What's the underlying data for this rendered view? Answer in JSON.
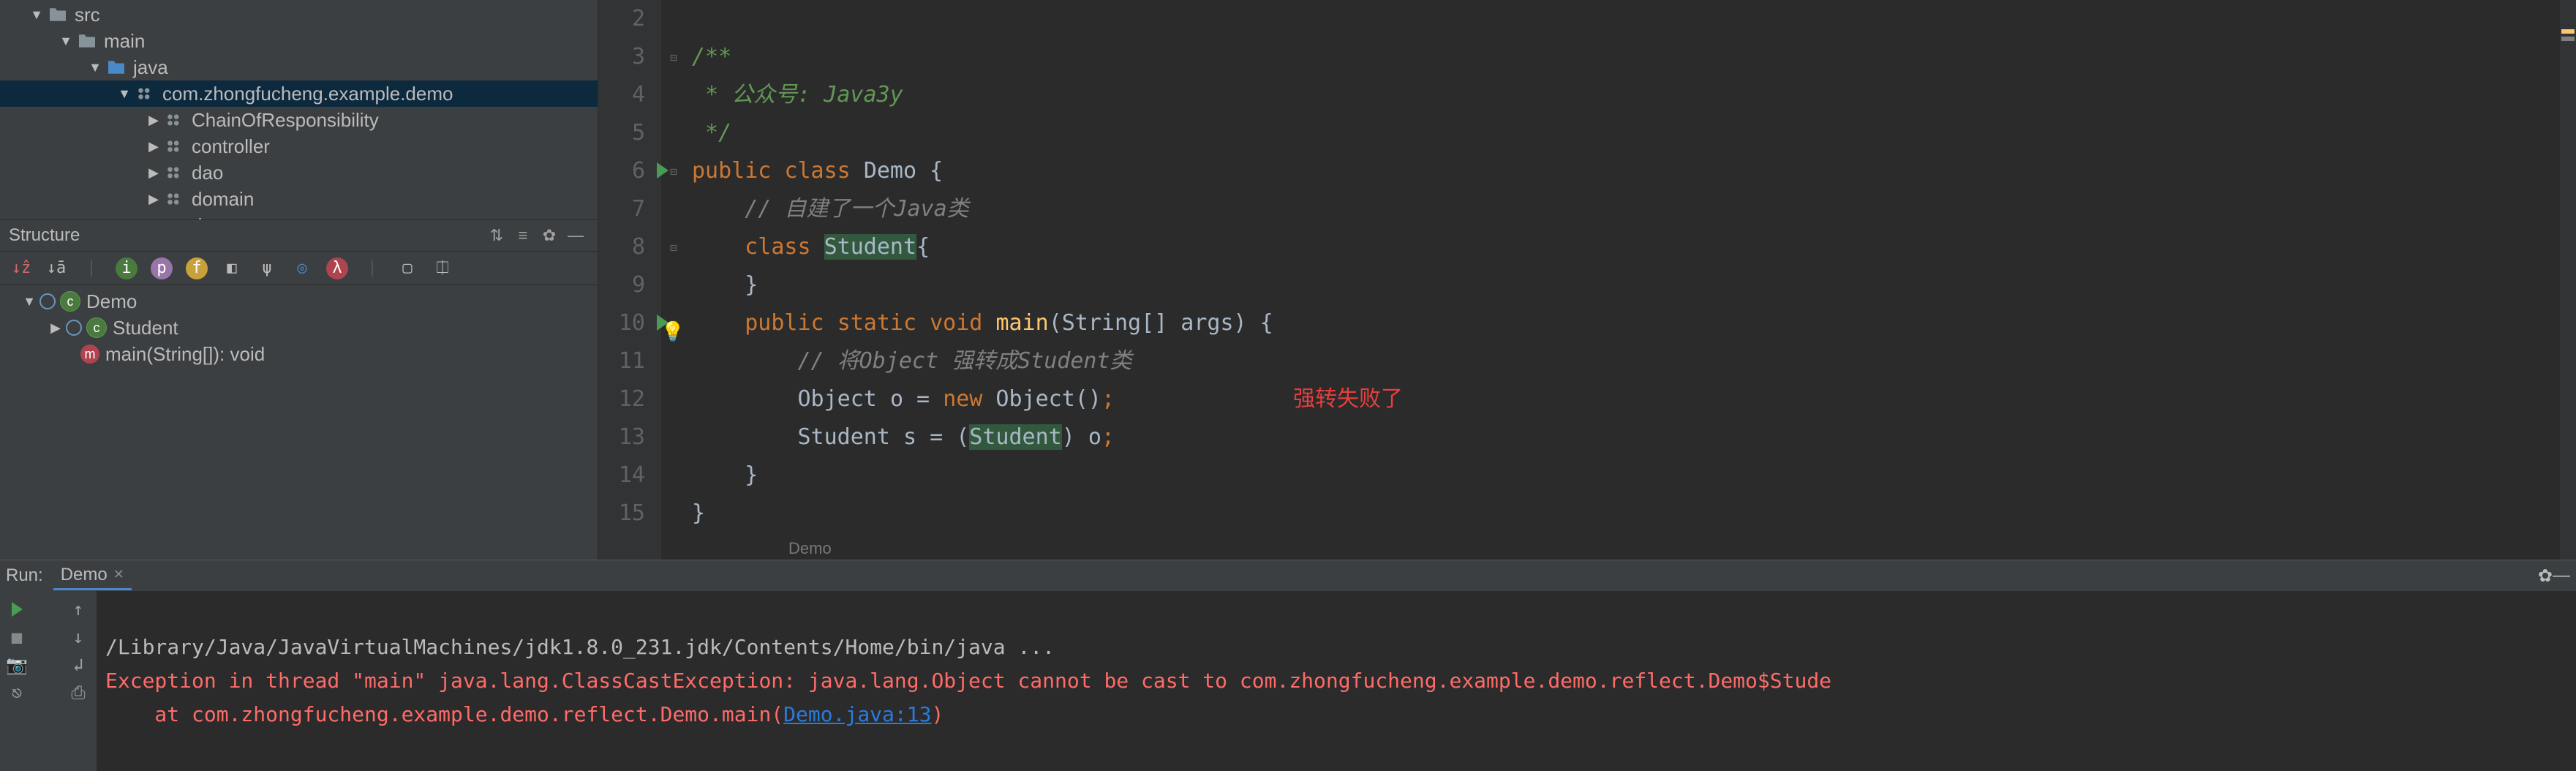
{
  "project": {
    "items": [
      {
        "indent": 40,
        "arrow": "▼",
        "icon": "folder",
        "label": "src"
      },
      {
        "indent": 80,
        "arrow": "▼",
        "icon": "folder",
        "label": "main"
      },
      {
        "indent": 120,
        "arrow": "▼",
        "icon": "java-folder",
        "label": "java"
      },
      {
        "indent": 160,
        "arrow": "▼",
        "icon": "pkg",
        "label": "com.zhongfucheng.example.demo",
        "selected": true
      },
      {
        "indent": 200,
        "arrow": "▶",
        "icon": "pkg",
        "label": "ChainOfResponsibility"
      },
      {
        "indent": 200,
        "arrow": "▶",
        "icon": "pkg",
        "label": "controller"
      },
      {
        "indent": 200,
        "arrow": "▶",
        "icon": "pkg",
        "label": "dao"
      },
      {
        "indent": 200,
        "arrow": "▶",
        "icon": "pkg",
        "label": "domain"
      },
      {
        "indent": 200,
        "arrow": "▶",
        "icon": "pkg",
        "label": "dto"
      }
    ]
  },
  "structure": {
    "title": "Structure",
    "items": [
      {
        "indent": 30,
        "arrow": "▼",
        "kind": "class",
        "label": "Demo"
      },
      {
        "indent": 66,
        "arrow": "▶",
        "kind": "class",
        "label": "Student"
      },
      {
        "indent": 86,
        "arrow": "",
        "kind": "method",
        "label": "main(String[]): void"
      }
    ]
  },
  "editor": {
    "breadcrumb": "Demo",
    "lines": [
      {
        "n": 2,
        "fold": "",
        "html": ""
      },
      {
        "n": 3,
        "fold": "⊟",
        "html": "<span class='jd'>/**</span>"
      },
      {
        "n": 4,
        "fold": "",
        "html": "<span class='jd'> * 公众号: Java3y</span>"
      },
      {
        "n": 5,
        "fold": "",
        "html": "<span class='jd'> */</span>"
      },
      {
        "n": 6,
        "fold": "⊟",
        "run": true,
        "html": "<span class='kw'>public</span> <span class='kw'>class</span> <span class='cls'>Demo</span> {"
      },
      {
        "n": 7,
        "fold": "",
        "html": "    <span class='cm'>// 自建了一个Java类</span>"
      },
      {
        "n": 8,
        "fold": "⊟",
        "html": "    <span class='kw'>class</span> <span class='hl'>Student</span>{"
      },
      {
        "n": 9,
        "fold": "",
        "html": "    }"
      },
      {
        "n": 10,
        "fold": "⊟",
        "run": true,
        "bulb": true,
        "html": "    <span class='kw'>public</span> <span class='kw'>static</span> <span class='kw'>void</span> <span class='mth'>main</span>(String[] args) {"
      },
      {
        "n": 11,
        "fold": "",
        "html": "        <span class='cm'>// 将Object 强转成Student类</span>"
      },
      {
        "n": 12,
        "fold": "",
        "html": "        Object <span class='ident'>o</span> = <span class='kw'>new</span> Object()<span class='kw'>;</span>"
      },
      {
        "n": 13,
        "fold": "",
        "html": "        Student <span class='ident'>s</span> = (<span class='hl'>Student</span>) o<span class='kw'>;</span>"
      },
      {
        "n": 14,
        "fold": "",
        "html": "    }"
      },
      {
        "n": 15,
        "fold": "",
        "html": "}"
      }
    ],
    "annotation": "强转失败了"
  },
  "run": {
    "label": "Run:",
    "tab": "Demo",
    "cmd": "/Library/Java/JavaVirtualMachines/jdk1.8.0_231.jdk/Contents/Home/bin/java ...",
    "err1_a": "Exception in thread \"main\" java.lang.ClassCastException: java.lang.Object cannot be cast to com.zhongfucheng.example.demo.reflect.Demo$Stude",
    "err2_a": "    at com.zhongfucheng.example.demo.reflect.Demo.main(",
    "err2_link": "Demo.java:13",
    "err2_b": ")"
  }
}
